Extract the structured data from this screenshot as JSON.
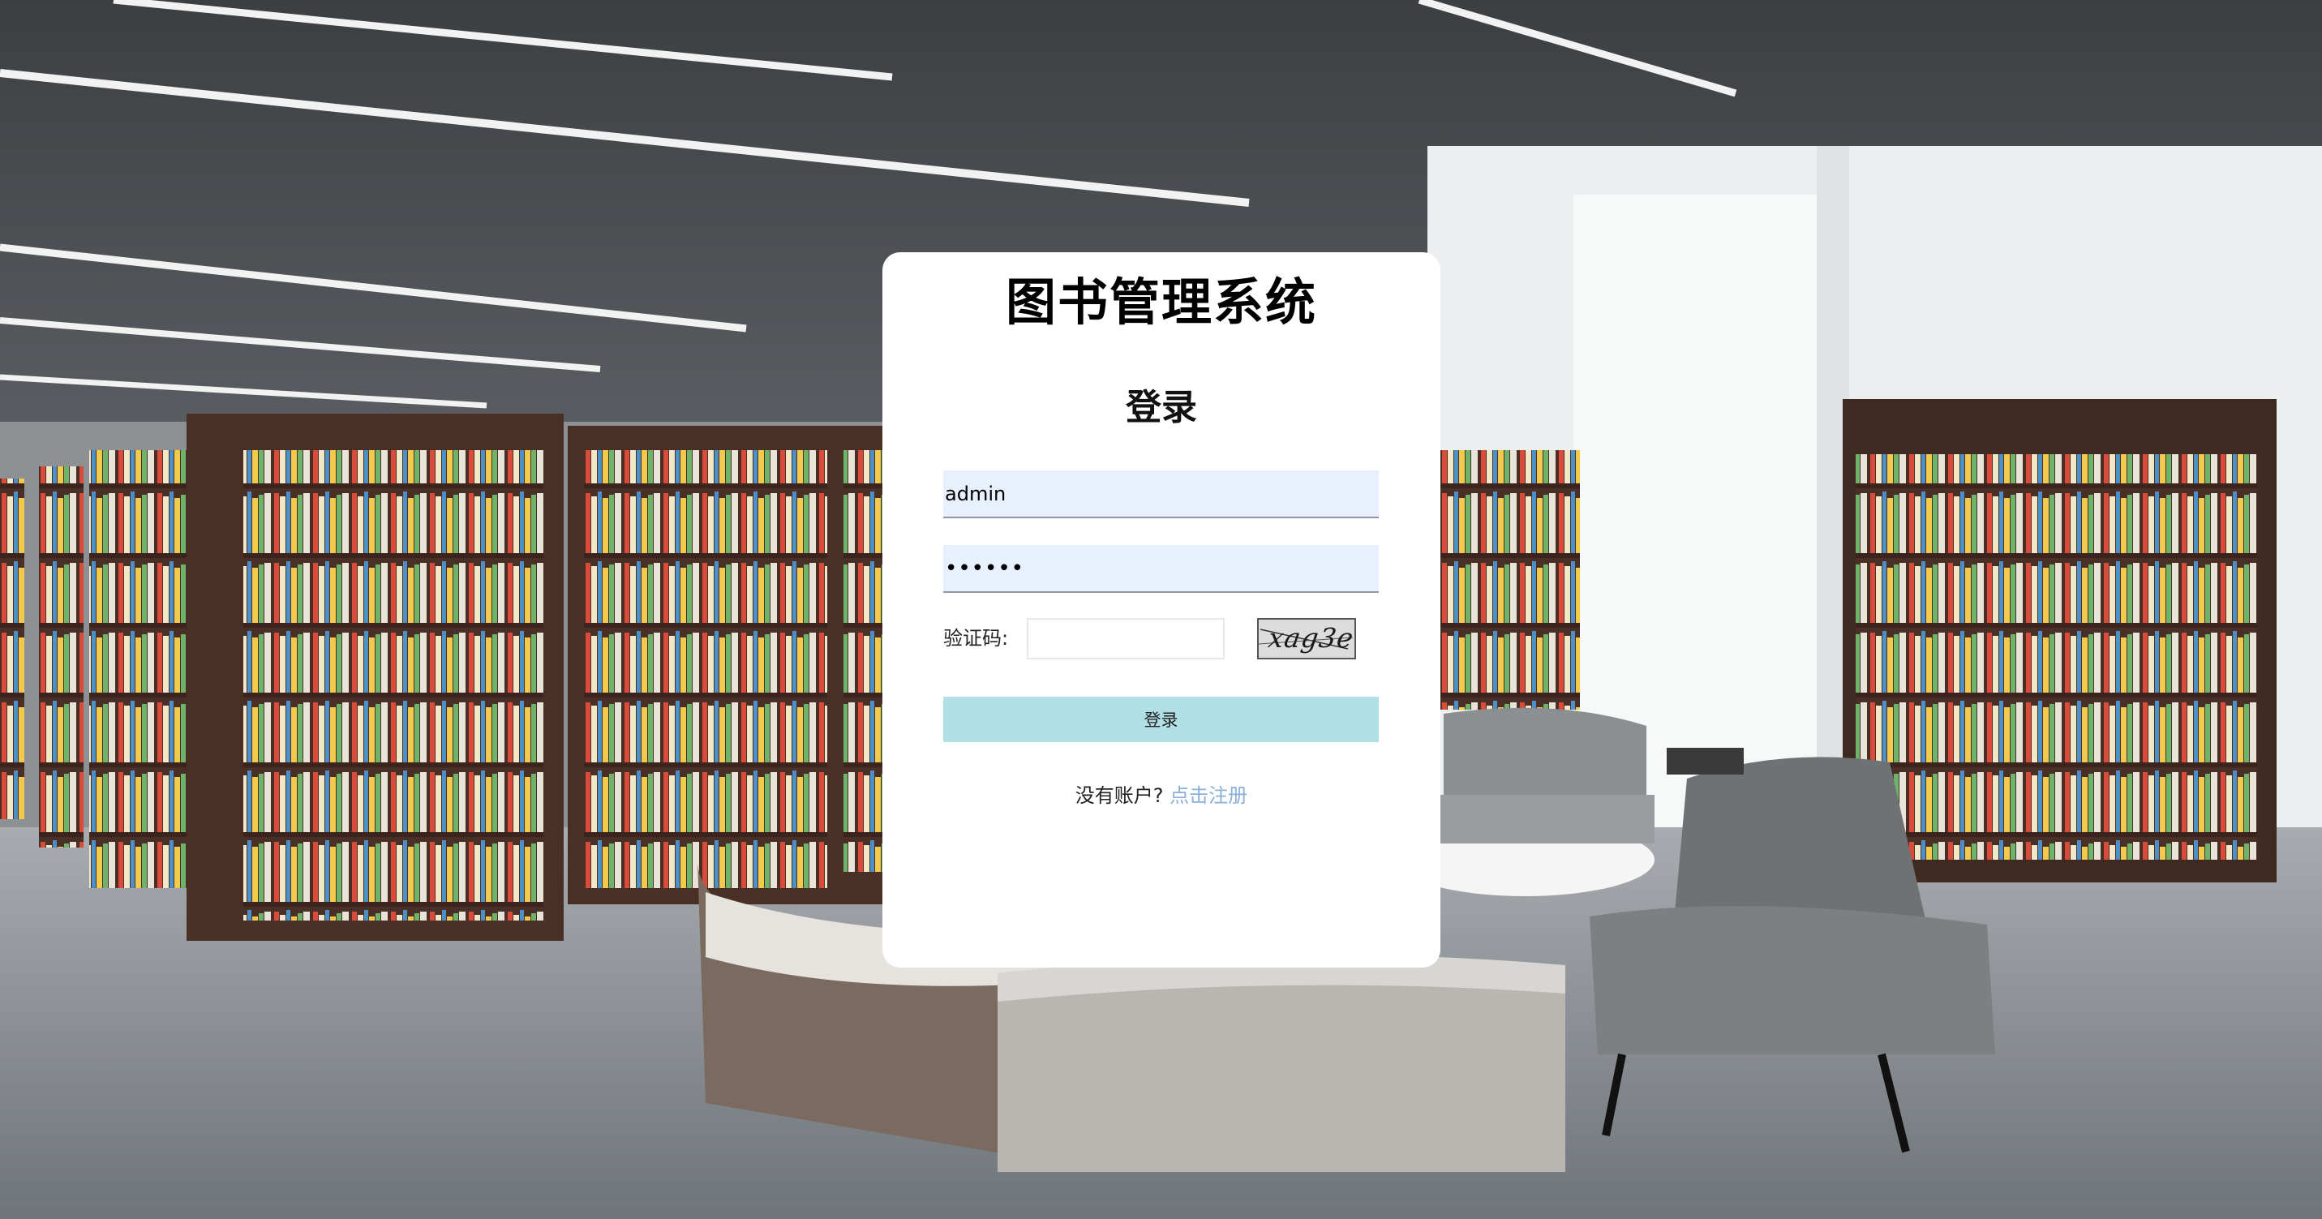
{
  "background": {
    "scene": "library-interior-photo"
  },
  "login_card": {
    "app_title": "图书管理系统",
    "heading": "登录",
    "username": {
      "value": "admin",
      "placeholder": ""
    },
    "password": {
      "masked_value": "••••••",
      "placeholder": ""
    },
    "captcha": {
      "label": "验证码:",
      "value": "",
      "image_text": "xag3e"
    },
    "submit_label": "登录",
    "register_prompt": "没有账户?",
    "register_link": "点击注册"
  },
  "colors": {
    "button_bg": "#b0e0e6",
    "input_bg": "#e8effd",
    "link": "#8ab0d8"
  }
}
